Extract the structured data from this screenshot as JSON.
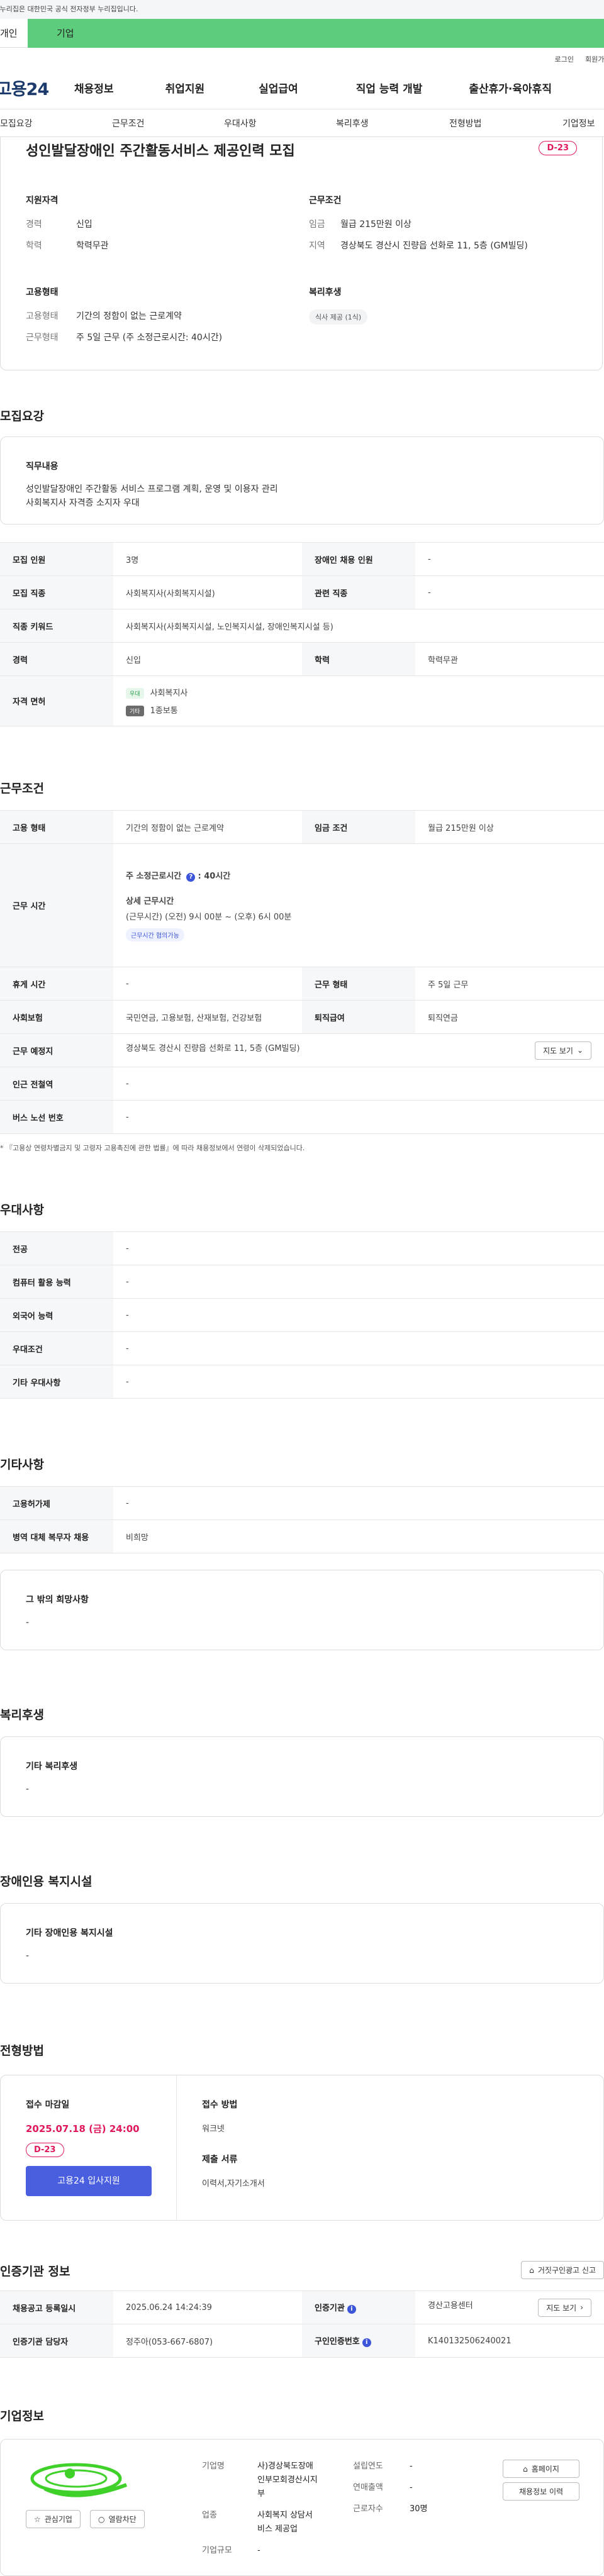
{
  "gov_banner": "이 누리집은 대한민국 공식 전자정부 누리집입니다.",
  "tabs": {
    "personal": "개인",
    "company": "기업"
  },
  "util": {
    "login": "로그인",
    "join": "회원가입"
  },
  "gnb": {
    "logo": "고용24",
    "items": [
      "채용정보",
      "취업지원",
      "실업급여",
      "직업 능력 개발",
      "출산휴가·육아휴직"
    ]
  },
  "subnav": [
    "모집요강",
    "근무조건",
    "우대사항",
    "복리후생",
    "전형방법",
    "기업정보"
  ],
  "summary": {
    "title": "성인발달장애인 주간활동서비스 제공인력 모집",
    "dday": "D-23",
    "qualification": {
      "head": "지원자격",
      "career_k": "경력",
      "career_v": "신입",
      "edu_k": "학력",
      "edu_v": "학력무관"
    },
    "conditions": {
      "head": "근무조건",
      "wage_k": "임금",
      "wage_v": "월급 215만원 이상",
      "region_k": "지역",
      "region_v": "경상북도 경산시 진량읍 선화로 11, 5층 (GM빌딩)"
    },
    "employment": {
      "head": "고용형태",
      "type_k": "고용형태",
      "type_v": "기간의 정함이 없는 근로계약",
      "shape_k": "근무형태",
      "shape_v": "주 5일 근무 (주 소정근로시간: 40시간)"
    },
    "benefits": {
      "head": "복리후생",
      "tag": "식사 제공 (1식)"
    }
  },
  "recruit": {
    "title": "모집요강",
    "duty_head": "직무내용",
    "duty_lines": [
      "성인발달장애인 주간활동 서비스 프로그램 계획, 운영 및 이용자 관리",
      "사회복지사 자격증 소지자 우대"
    ],
    "rows": {
      "headcount_k": "모집 인원",
      "headcount_v": "3명",
      "disabled_k": "장애인 채용 인원",
      "disabled_v": "-",
      "occupation_k": "모집 직종",
      "occupation_v": "사회복지사(사회복지시설)",
      "related_k": "관련 직종",
      "related_v": "-",
      "keyword_k": "직종 키워드",
      "keyword_v": "사회복지사(사회복지시설, 노인복지시설, 장애인복지시설 등)",
      "career_k": "경력",
      "career_v": "신입",
      "edu_k": "학력",
      "edu_v": "학력무관",
      "license_k": "자격 면허",
      "license_1_tag": "우대",
      "license_1": "사회복지사",
      "license_2_tag": "기타",
      "license_2": "1종보통"
    }
  },
  "work": {
    "title": "근무조건",
    "emp_k": "고용 형태",
    "emp_v": "기간의 정함이 없는 근로계약",
    "wage_k": "임금 조건",
    "wage_v": "월급 215만원 이상",
    "hours_k": "근무 시간",
    "hours_weekly_label": "주 소정근로시간",
    "hours_weekly_value": ": 40시간",
    "hours_detail_label": "상세 근무시간",
    "hours_detail": "(근무시간) (오전) 9시 00분 ~ (오후) 6시 00분",
    "hours_tag": "근무시간 협의가능",
    "rest_k": "휴게 시간",
    "rest_v": "-",
    "shape_k": "근무 형태",
    "shape_v": "주 5일 근무",
    "insurance_k": "사회보험",
    "insurance_v": "국민연금, 고용보험, 산재보험, 건강보험",
    "retire_k": "퇴직급여",
    "retire_v": "퇴직연금",
    "place_k": "근무 예정지",
    "place_v": "경상북도 경산시 진량읍 선화로 11, 5층 (GM빌딩)",
    "map_btn": "지도 보기",
    "station_k": "인근 전철역",
    "station_v": "-",
    "bus_k": "버스 노선 번호",
    "bus_v": "-",
    "note": "* 『고용상 연령차별금지 및 고령자 고용촉진에 관한 법률』에 따라 채용정보에서 연령이 삭제되었습니다."
  },
  "prefer": {
    "title": "우대사항",
    "major_k": "전공",
    "major_v": "-",
    "computer_k": "컴퓨터 활용 능력",
    "computer_v": "-",
    "language_k": "외국어 능력",
    "language_v": "-",
    "cond_k": "우대조건",
    "cond_v": "-",
    "etc_k": "기타 우대사항",
    "etc_v": "-"
  },
  "etc": {
    "title": "기타사항",
    "permit_k": "고용허가제",
    "permit_v": "-",
    "military_k": "병역 대체 복무자 채용",
    "military_v": "비희망",
    "wish_head": "그 밖의 희망사항",
    "wish_v": "-"
  },
  "welfare": {
    "title": "복리후생",
    "head": "기타 복리후생",
    "v": "-"
  },
  "disabled_facility": {
    "title": "장애인용 복지시설",
    "head": "기타 장애인용 복지시설",
    "v": "-"
  },
  "process": {
    "title": "전형방법",
    "deadline_label": "접수 마감일",
    "deadline": "2025.07.18 (금) 24:00",
    "dday": "D-23",
    "apply_btn": "고용24 입사지원",
    "method_label": "접수 방법",
    "method_v": "워크넷",
    "docs_label": "제출 서류",
    "docs_v": "이력서,자기소개서"
  },
  "cert": {
    "title": "인증기관 정보",
    "report_btn": "거짓구인광고 신고",
    "reg_k": "채용공고 등록일시",
    "reg_v": "2025.06.24 14:24:39",
    "org_k": "인증기관",
    "org_v": "경산고용센터",
    "map_btn": "지도 보기",
    "manager_k": "인증기관 담당자",
    "manager_v": "정주아(053-667-6807)",
    "reqno_k": "구인인증번호",
    "reqno_v": "K140132506240021"
  },
  "company": {
    "title": "기업정보",
    "interest_btn": "관심기업",
    "block_btn": "열람차단",
    "name_k": "기업명",
    "name_lines": [
      "사)경상북도장애",
      "인부모회경산시지",
      "부"
    ],
    "industry_k": "업종",
    "industry_lines": [
      "사회복지 상담서",
      "비스 제공업"
    ],
    "size_k": "기업규모",
    "size_v": "-",
    "founded_k": "설립연도",
    "founded_v": "-",
    "sales_k": "연매출액",
    "sales_v": "-",
    "employees_k": "근로자수",
    "employees_v": "30명",
    "homepage_btn": "홈페이지",
    "history_btn": "채용정보 이력"
  },
  "colors": {
    "accent_green": "#5dcc7d",
    "accent_pink": "#e0185b",
    "accent_blue": "#4a5fe0"
  }
}
